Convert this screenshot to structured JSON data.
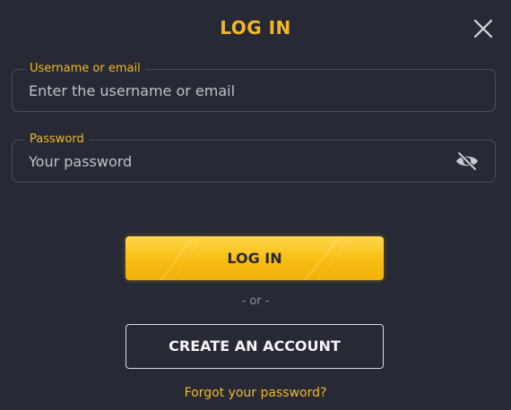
{
  "modal": {
    "title": "LOG IN"
  },
  "username": {
    "label": "Username or email",
    "placeholder": "Enter the username or email",
    "value": ""
  },
  "password": {
    "label": "Password",
    "placeholder": "Your password",
    "value": "",
    "visibility_icon": "eye-off-icon"
  },
  "actions": {
    "login_label": "LOG IN",
    "separator": "- or -",
    "create_account_label": "CREATE AN ACCOUNT",
    "forgot_password_label": "Forgot your password?"
  },
  "colors": {
    "accent": "#f2b824",
    "background": "#272935",
    "field_border": "#4b4d5a",
    "button_text_dark": "#2a2a30",
    "button_text_light": "#f4f4f6"
  }
}
